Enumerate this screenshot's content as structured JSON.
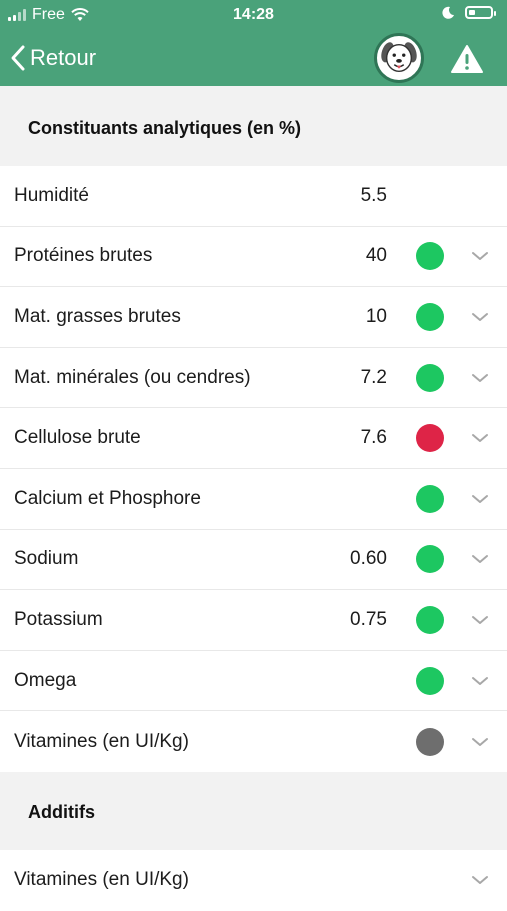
{
  "status_bar": {
    "carrier": "Free",
    "time": "14:28",
    "battery_level": 0.3
  },
  "nav": {
    "back_label": "Retour",
    "avatar_icon": "dog-face-icon",
    "warning_icon": "warning-triangle-icon"
  },
  "colors": {
    "header_bg": "#4aa27a",
    "good": "#1dc761",
    "bad": "#de2447",
    "neutral": "#6e6e6e"
  },
  "sections": [
    {
      "title": "Constituants analytiques (en %)",
      "rows": [
        {
          "label": "Humidité",
          "value": "5.5",
          "status": "",
          "expandable": false
        },
        {
          "label": "Protéines brutes",
          "value": "40",
          "status": "good",
          "expandable": true
        },
        {
          "label": "Mat. grasses brutes",
          "value": "10",
          "status": "good",
          "expandable": true
        },
        {
          "label": "Mat. minérales (ou cendres)",
          "value": "7.2",
          "status": "good",
          "expandable": true
        },
        {
          "label": "Cellulose brute",
          "value": "7.6",
          "status": "bad",
          "expandable": true
        },
        {
          "label": "Calcium et Phosphore",
          "value": "",
          "status": "good",
          "expandable": true
        },
        {
          "label": "Sodium",
          "value": "0.60",
          "status": "good",
          "expandable": true
        },
        {
          "label": "Potassium",
          "value": "0.75",
          "status": "good",
          "expandable": true
        },
        {
          "label": "Omega",
          "value": "",
          "status": "good",
          "expandable": true
        },
        {
          "label": "Vitamines (en UI/Kg)",
          "value": "",
          "status": "neutral",
          "expandable": true
        }
      ]
    },
    {
      "title": "Additifs",
      "rows": [
        {
          "label": "Vitamines (en UI/Kg)",
          "value": "",
          "status": "",
          "expandable": true
        }
      ]
    }
  ]
}
